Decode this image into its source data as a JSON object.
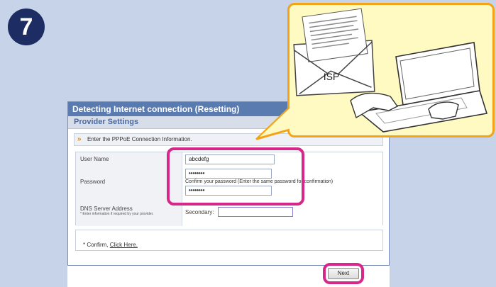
{
  "step": {
    "number": "7"
  },
  "dialog": {
    "title": "Detecting Internet connection (Resetting)",
    "section": "Provider Settings",
    "instruction": "Enter the PPPoE Connection Information.",
    "fields": {
      "username": {
        "label": "User Name",
        "value": "abcdefg"
      },
      "password": {
        "label": "Password",
        "value": "••••••••",
        "confirm_note": "Confirm your password (Enter the same password for confirmation)",
        "confirm_value": "••••••••"
      },
      "dns": {
        "label": "DNS Server Address",
        "note": "* Enter information if required by your provider.",
        "secondary_label": "Secondary:",
        "secondary_value": ""
      }
    },
    "confirm": {
      "prefix": "* Confirm, ",
      "link": "Click Here."
    },
    "next_label": "Next"
  },
  "callout": {
    "envelope_label": "ISP"
  },
  "colors": {
    "badge": "#1d2c63",
    "highlight": "#d6278a",
    "callout_border": "#f3a316",
    "callout_fill": "#fff9c2",
    "background": "#c6d3e9"
  }
}
